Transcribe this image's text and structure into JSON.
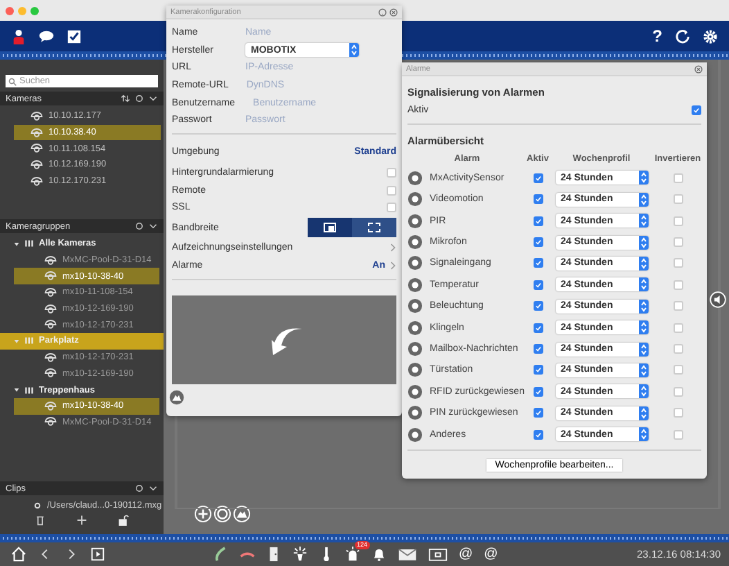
{
  "header": {
    "help": "?"
  },
  "sidebar": {
    "search": {
      "placeholder": "Suchen"
    },
    "cameras": {
      "title": "Kameras",
      "items": [
        {
          "label": "10.10.12.177",
          "selected": false
        },
        {
          "label": "10.10.38.40",
          "selected": true
        },
        {
          "label": "10.11.108.154",
          "selected": false
        },
        {
          "label": "10.12.169.190",
          "selected": false
        },
        {
          "label": "10.12.170.231",
          "selected": false
        }
      ]
    },
    "groups": {
      "title": "Kameragruppen",
      "tree": [
        {
          "label": "Alle Kameras",
          "expanded": true,
          "selected": false,
          "children": [
            {
              "label": "MxMC-Pool-D-31-D14",
              "selected": false
            },
            {
              "label": "mx10-10-38-40",
              "selected": true
            },
            {
              "label": "mx10-11-108-154",
              "selected": false
            },
            {
              "label": "mx10-12-169-190",
              "selected": false
            },
            {
              "label": "mx10-12-170-231",
              "selected": false
            }
          ]
        },
        {
          "label": "Parkplatz",
          "expanded": true,
          "selected": true,
          "children": [
            {
              "label": "mx10-12-170-231",
              "selected": false
            },
            {
              "label": "mx10-12-169-190",
              "selected": false
            }
          ]
        },
        {
          "label": "Treppenhaus",
          "expanded": true,
          "selected": false,
          "children": [
            {
              "label": "mx10-10-38-40",
              "selected": true
            },
            {
              "label": "MxMC-Pool-D-31-D14",
              "selected": false
            }
          ]
        }
      ]
    },
    "clips": {
      "title": "Clips",
      "items": [
        "/Users/claud...0-190112.mxg"
      ]
    }
  },
  "camera_config": {
    "title": "Kamerakonfiguration",
    "fields": [
      {
        "label": "Name",
        "placeholder": "Name"
      },
      {
        "label": "Hersteller",
        "value": "MOBOTIX",
        "kind": "select"
      },
      {
        "label": "URL",
        "placeholder": "IP-Adresse"
      },
      {
        "label": "Remote-URL",
        "placeholder": "DynDNS"
      },
      {
        "label": "Benutzername",
        "placeholder": "Benutzername"
      },
      {
        "label": "Passwort",
        "placeholder": "Passwort"
      }
    ],
    "environment": {
      "label": "Umgebung",
      "value": "Standard"
    },
    "options": [
      {
        "label": "Hintergrundalarmierung",
        "checked": false
      },
      {
        "label": "Remote",
        "checked": false
      },
      {
        "label": "SSL",
        "checked": false
      }
    ],
    "bandwidth": {
      "label": "Bandbreite",
      "options": [
        {
          "selected": true
        },
        {
          "selected": false
        }
      ]
    },
    "links": [
      {
        "label": "Aufzeichnungseinstellungen"
      },
      {
        "label": "Alarme",
        "value": "An"
      }
    ]
  },
  "alarms": {
    "title": "Alarme",
    "signal_title": "Signalisierung von Alarmen",
    "active_label": "Aktiv",
    "active": true,
    "overview_title": "Alarmübersicht",
    "columns": [
      "Alarm",
      "Aktiv",
      "Wochenprofil",
      "Invertieren"
    ],
    "rows": [
      {
        "name": "MxActivitySensor",
        "active": true,
        "profile": "24 Stunden",
        "inverted": false
      },
      {
        "name": "Videomotion",
        "active": true,
        "profile": "24 Stunden",
        "inverted": false
      },
      {
        "name": "PIR",
        "active": true,
        "profile": "24 Stunden",
        "inverted": false
      },
      {
        "name": "Mikrofon",
        "active": true,
        "profile": "24 Stunden",
        "inverted": false
      },
      {
        "name": "Signaleingang",
        "active": true,
        "profile": "24 Stunden",
        "inverted": false
      },
      {
        "name": "Temperatur",
        "active": true,
        "profile": "24 Stunden",
        "inverted": false
      },
      {
        "name": "Beleuchtung",
        "active": true,
        "profile": "24 Stunden",
        "inverted": false
      },
      {
        "name": "Klingeln",
        "active": true,
        "profile": "24 Stunden",
        "inverted": false
      },
      {
        "name": "Mailbox-Nachrichten",
        "active": true,
        "profile": "24 Stunden",
        "inverted": false
      },
      {
        "name": "Türstation",
        "active": true,
        "profile": "24 Stunden",
        "inverted": false
      },
      {
        "name": "RFID zurückgewiesen",
        "active": true,
        "profile": "24 Stunden",
        "inverted": false
      },
      {
        "name": "PIN zurückgewiesen",
        "active": true,
        "profile": "24 Stunden",
        "inverted": false
      },
      {
        "name": "Anderes",
        "active": true,
        "profile": "24 Stunden",
        "inverted": false
      }
    ],
    "edit_button": "Wochenprofile bearbeiten..."
  },
  "toolbar": {
    "alarm_badge": "124",
    "mail_links": [
      "@",
      "@"
    ],
    "clock": "23.12.16 08:14:30"
  }
}
